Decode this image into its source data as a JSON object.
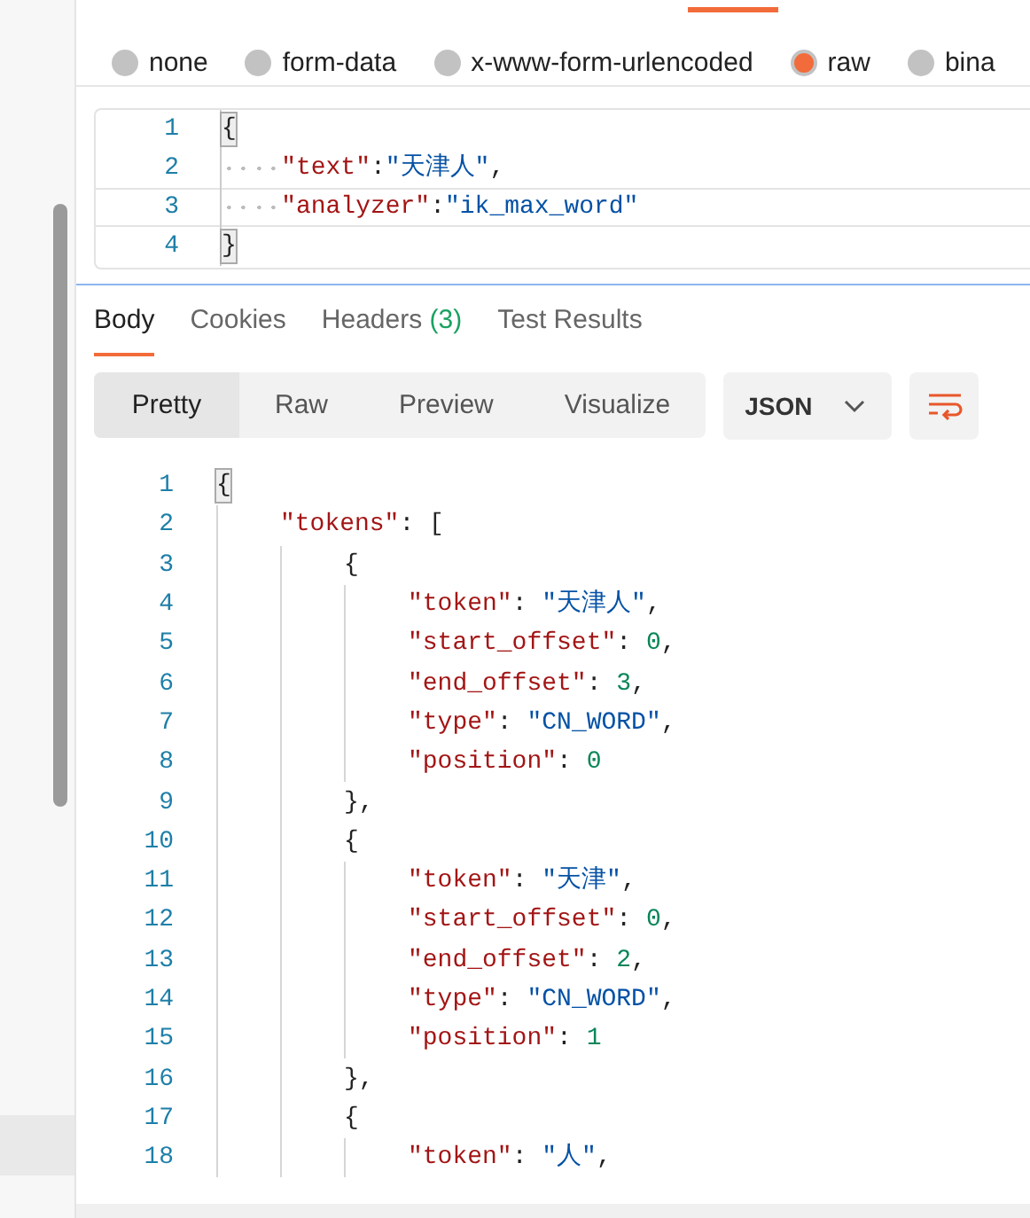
{
  "body_modes": [
    {
      "label": "none",
      "selected": false
    },
    {
      "label": "form-data",
      "selected": false
    },
    {
      "label": "x-www-form-urlencoded",
      "selected": false
    },
    {
      "label": "raw",
      "selected": true
    },
    {
      "label": "bina",
      "selected": false
    }
  ],
  "request_editor": {
    "lines": [
      {
        "number": "1",
        "text": "{",
        "active": false,
        "bracket_match": true
      },
      {
        "number": "2",
        "text": "    \"text\":\"天津人\",",
        "active": false,
        "bracket_match": false
      },
      {
        "number": "3",
        "text": "    \"analyzer\":\"ik_max_word\"",
        "active": true,
        "bracket_match": false
      },
      {
        "number": "4",
        "text": "}",
        "active": false,
        "bracket_match": true
      }
    ]
  },
  "response_tabs": [
    {
      "label": "Body",
      "selected": true
    },
    {
      "label": "Cookies",
      "selected": false
    },
    {
      "label": "Headers",
      "count": "(3)",
      "selected": false
    },
    {
      "label": "Test Results",
      "selected": false
    }
  ],
  "view_modes": [
    {
      "label": "Pretty",
      "selected": true
    },
    {
      "label": "Raw",
      "selected": false
    },
    {
      "label": "Preview",
      "selected": false
    },
    {
      "label": "Visualize",
      "selected": false
    }
  ],
  "format_dropdown": {
    "value": "JSON"
  },
  "response_body": {
    "lines": [
      {
        "number": "1",
        "text": "{",
        "bracket_match": true
      },
      {
        "number": "2",
        "text": "    \"tokens\": [",
        "bracket_match": false
      },
      {
        "number": "3",
        "text": "        {",
        "bracket_match": false
      },
      {
        "number": "4",
        "text": "            \"token\": \"天津人\",",
        "bracket_match": false
      },
      {
        "number": "5",
        "text": "            \"start_offset\": 0,",
        "bracket_match": false
      },
      {
        "number": "6",
        "text": "            \"end_offset\": 3,",
        "bracket_match": false
      },
      {
        "number": "7",
        "text": "            \"type\": \"CN_WORD\",",
        "bracket_match": false
      },
      {
        "number": "8",
        "text": "            \"position\": 0",
        "bracket_match": false
      },
      {
        "number": "9",
        "text": "        },",
        "bracket_match": false
      },
      {
        "number": "10",
        "text": "        {",
        "bracket_match": false
      },
      {
        "number": "11",
        "text": "            \"token\": \"天津\",",
        "bracket_match": false
      },
      {
        "number": "12",
        "text": "            \"start_offset\": 0,",
        "bracket_match": false
      },
      {
        "number": "13",
        "text": "            \"end_offset\": 2,",
        "bracket_match": false
      },
      {
        "number": "14",
        "text": "            \"type\": \"CN_WORD\",",
        "bracket_match": false
      },
      {
        "number": "15",
        "text": "            \"position\": 1",
        "bracket_match": false
      },
      {
        "number": "16",
        "text": "        },",
        "bracket_match": false
      },
      {
        "number": "17",
        "text": "        {",
        "bracket_match": false
      },
      {
        "number": "18",
        "text": "            \"token\": \"人\",",
        "bracket_match": false
      }
    ]
  }
}
